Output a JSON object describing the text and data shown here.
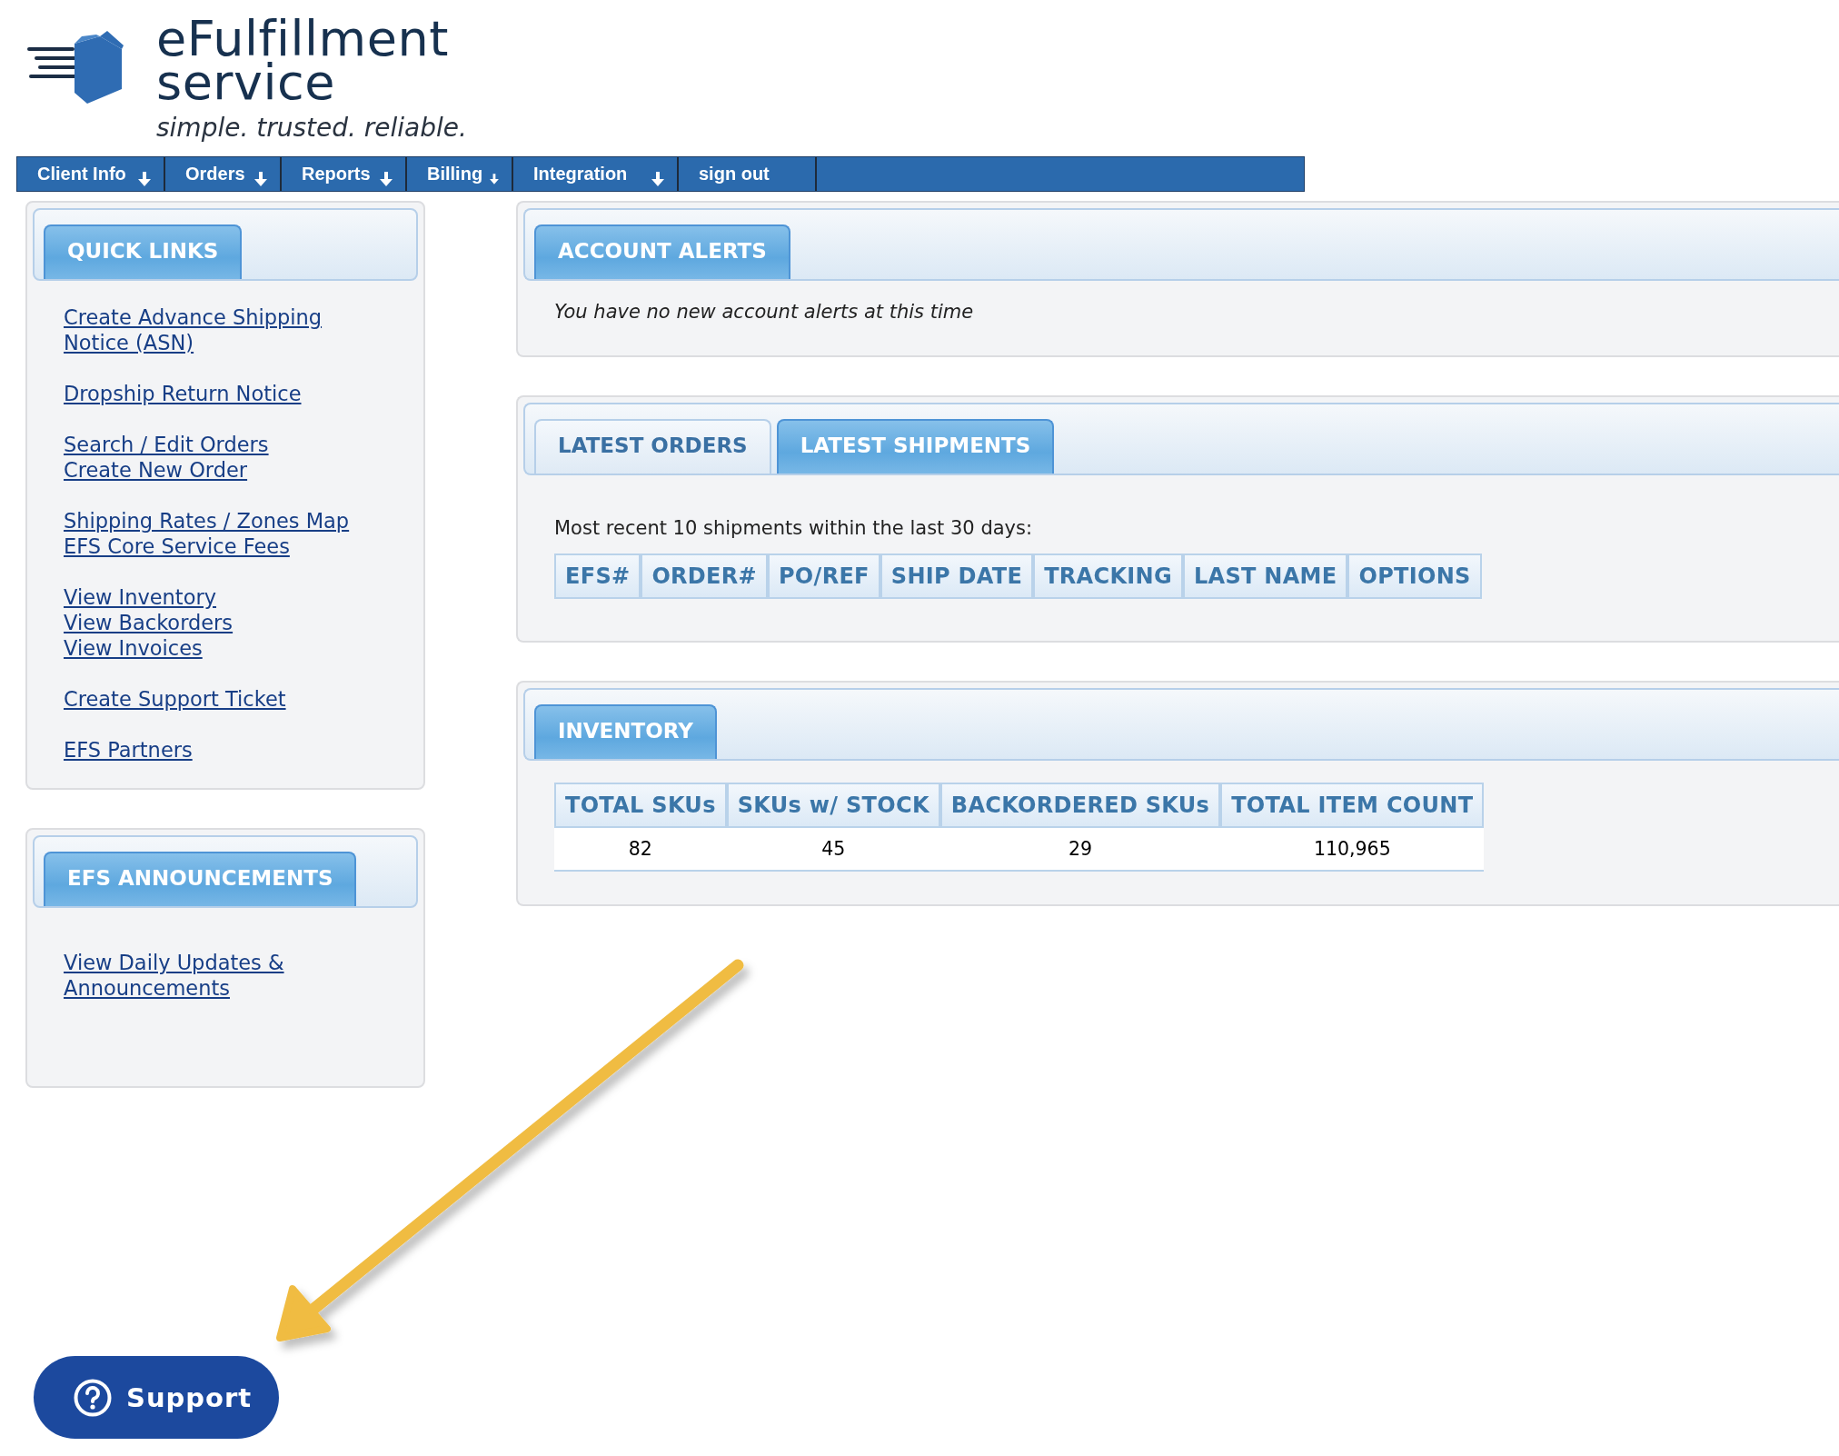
{
  "logo": {
    "line_1": "eFulfillment",
    "line_2": "service",
    "tagline": "simple. trusted. reliable."
  },
  "nav": [
    {
      "label": "Client Info",
      "dropdown": true
    },
    {
      "label": "Orders",
      "dropdown": true
    },
    {
      "label": "Reports",
      "dropdown": true
    },
    {
      "label": "Billing",
      "dropdown": true
    },
    {
      "label": "Integration",
      "dropdown": true
    },
    {
      "label": "sign out",
      "dropdown": false
    }
  ],
  "quick_links": {
    "title": "QUICK LINKS",
    "groups": [
      [
        "Create Advance Shipping Notice (ASN)"
      ],
      [
        "Dropship Return Notice"
      ],
      [
        "Search / Edit Orders",
        "Create New Order"
      ],
      [
        "Shipping Rates / Zones Map",
        "EFS Core Service Fees"
      ],
      [
        "View Inventory",
        "View Backorders",
        "View Invoices"
      ],
      [
        "Create Support Ticket"
      ],
      [
        "EFS Partners"
      ]
    ]
  },
  "announcements": {
    "title": "EFS ANNOUNCEMENTS",
    "links": [
      "View Daily Updates & Announcements"
    ]
  },
  "account_alerts": {
    "title": "ACCOUNT ALERTS",
    "message": "You have no new account alerts at this time"
  },
  "shipments": {
    "tabs": [
      {
        "label": "LATEST ORDERS",
        "selected": false
      },
      {
        "label": "LATEST SHIPMENTS",
        "selected": true
      }
    ],
    "caption": "Most recent 10 shipments within the last 30 days:",
    "columns": [
      "EFS#",
      "ORDER#",
      "PO/REF",
      "SHIP DATE",
      "TRACKING",
      "LAST NAME",
      "OPTIONS"
    ]
  },
  "inventory": {
    "title": "INVENTORY",
    "columns": [
      "TOTAL SKUs",
      "SKUs w/ STOCK",
      "BACKORDERED SKUs",
      "TOTAL ITEM COUNT"
    ],
    "rows": [
      [
        "82",
        "45",
        "29",
        "110,965"
      ]
    ]
  },
  "support_button": {
    "label": "Support"
  }
}
